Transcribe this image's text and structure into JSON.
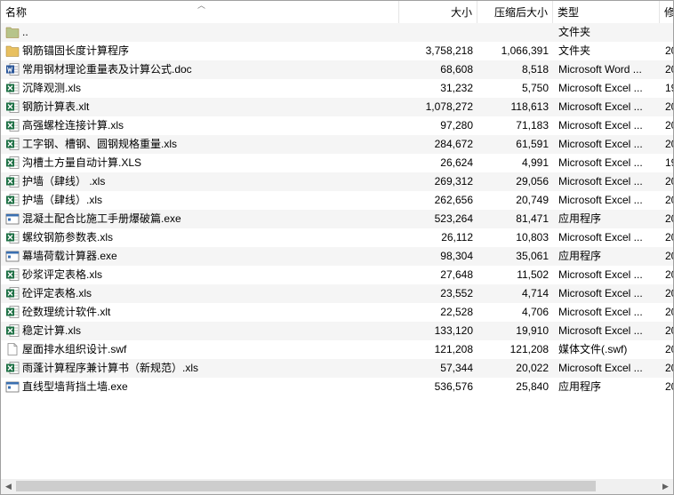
{
  "columns": {
    "name": "名称",
    "size": "大小",
    "compressed": "压缩后大小",
    "type": "类型",
    "modified": "修"
  },
  "icons": {
    "sort": "sort-up-icon",
    "folder_color": "#e8c060",
    "parent_folder_color": "#b7c48a",
    "excel_color": "#1d7044",
    "word_color": "#2b579a",
    "exe_color": "#3a6fb0"
  },
  "rows": [
    {
      "name": "..",
      "size": "",
      "compressed": "",
      "type": "文件夹",
      "modified": "",
      "icon": "parent-folder"
    },
    {
      "name": "钢筋锚固长度计算程序",
      "size": "3,758,218",
      "compressed": "1,066,391",
      "type": "文件夹",
      "modified": "20",
      "icon": "folder"
    },
    {
      "name": "常用钢材理论重量表及计算公式.doc",
      "size": "68,608",
      "compressed": "8,518",
      "type": "Microsoft Word ...",
      "modified": "20",
      "icon": "word"
    },
    {
      "name": "沉降观测.xls",
      "size": "31,232",
      "compressed": "5,750",
      "type": "Microsoft Excel ...",
      "modified": "19",
      "icon": "excel"
    },
    {
      "name": "钢筋计算表.xlt",
      "size": "1,078,272",
      "compressed": "118,613",
      "type": "Microsoft Excel ...",
      "modified": "20",
      "icon": "excel"
    },
    {
      "name": "高强螺栓连接计算.xls",
      "size": "97,280",
      "compressed": "71,183",
      "type": "Microsoft Excel ...",
      "modified": "20",
      "icon": "excel"
    },
    {
      "name": "工字钢、槽钢、圆钢规格重量.xls",
      "size": "284,672",
      "compressed": "61,591",
      "type": "Microsoft Excel ...",
      "modified": "20",
      "icon": "excel"
    },
    {
      "name": "沟槽土方量自动计算.XLS",
      "size": "26,624",
      "compressed": "4,991",
      "type": "Microsoft Excel ...",
      "modified": "19",
      "icon": "excel"
    },
    {
      "name": "护墙（肆线）  .xls",
      "size": "269,312",
      "compressed": "29,056",
      "type": "Microsoft Excel ...",
      "modified": "20",
      "icon": "excel"
    },
    {
      "name": "护墙（肆线）.xls",
      "size": "262,656",
      "compressed": "20,749",
      "type": "Microsoft Excel ...",
      "modified": "20",
      "icon": "excel"
    },
    {
      "name": "混凝土配合比施工手册爆破篇.exe",
      "size": "523,264",
      "compressed": "81,471",
      "type": "应用程序",
      "modified": "20",
      "icon": "exe"
    },
    {
      "name": "螺纹钢筋参数表.xls",
      "size": "26,112",
      "compressed": "10,803",
      "type": "Microsoft Excel ...",
      "modified": "20",
      "icon": "excel"
    },
    {
      "name": "幕墙荷载计算器.exe",
      "size": "98,304",
      "compressed": "35,061",
      "type": "应用程序",
      "modified": "20",
      "icon": "exe"
    },
    {
      "name": "砂浆评定表格.xls",
      "size": "27,648",
      "compressed": "11,502",
      "type": "Microsoft Excel ...",
      "modified": "20",
      "icon": "excel"
    },
    {
      "name": "砼评定表格.xls",
      "size": "23,552",
      "compressed": "4,714",
      "type": "Microsoft Excel ...",
      "modified": "20",
      "icon": "excel"
    },
    {
      "name": "砼数理统计软件.xlt",
      "size": "22,528",
      "compressed": "4,706",
      "type": "Microsoft Excel ...",
      "modified": "20",
      "icon": "excel"
    },
    {
      "name": "稳定计算.xls",
      "size": "133,120",
      "compressed": "19,910",
      "type": "Microsoft Excel ...",
      "modified": "20",
      "icon": "excel"
    },
    {
      "name": "屋面排水组织设计.swf",
      "size": "121,208",
      "compressed": "121,208",
      "type": "媒体文件(.swf)",
      "modified": "20",
      "icon": "swf"
    },
    {
      "name": "雨蓬计算程序兼计算书（新规范）.xls",
      "size": "57,344",
      "compressed": "20,022",
      "type": "Microsoft Excel ...",
      "modified": "20",
      "icon": "excel"
    },
    {
      "name": "直线型墙背挡土墙.exe",
      "size": "536,576",
      "compressed": "25,840",
      "type": "应用程序",
      "modified": "20",
      "icon": "exe"
    }
  ]
}
